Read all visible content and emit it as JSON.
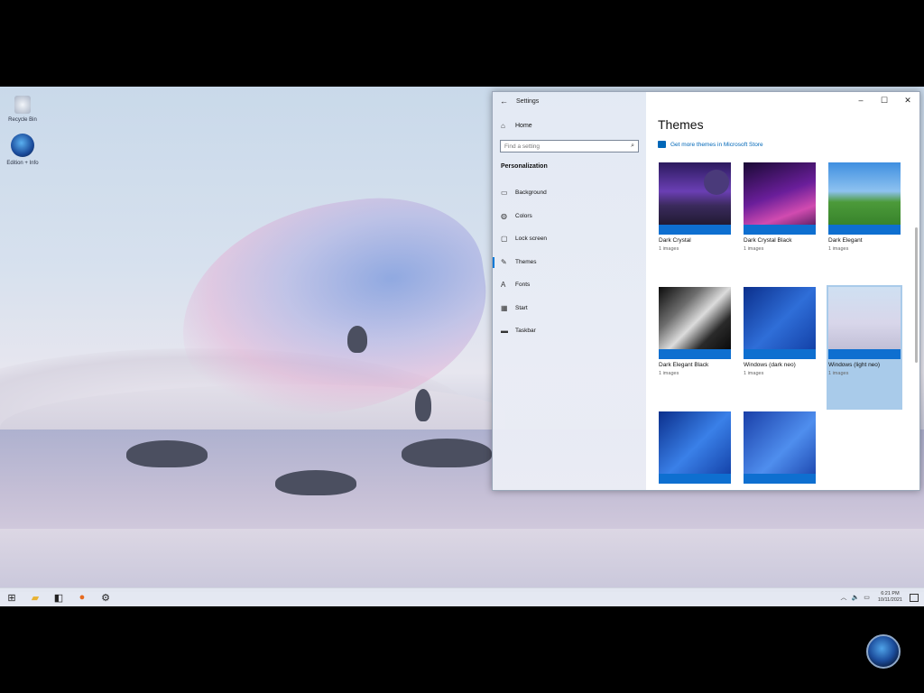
{
  "desktop": {
    "icons": [
      {
        "label": "Recycle Bin",
        "icon": "recycle-bin-icon"
      },
      {
        "label": "Edition + Info",
        "icon": "globe-icon"
      }
    ]
  },
  "settings": {
    "titlebar": {
      "title": "Settings",
      "back": "←"
    },
    "controls": {
      "minimize": "–",
      "maximize": "☐",
      "close": "✕"
    },
    "nav": {
      "home": "Home",
      "search_placeholder": "Find a setting",
      "section": "Personalization",
      "items": [
        {
          "label": "Background",
          "icon": "image-icon",
          "glyph": "▭"
        },
        {
          "label": "Colors",
          "icon": "palette-icon",
          "glyph": "◍"
        },
        {
          "label": "Lock screen",
          "icon": "lock-screen-icon",
          "glyph": "▢"
        },
        {
          "label": "Themes",
          "icon": "brush-icon",
          "glyph": "✎"
        },
        {
          "label": "Fonts",
          "icon": "font-icon",
          "glyph": "A"
        },
        {
          "label": "Start",
          "icon": "start-icon",
          "glyph": "▦"
        },
        {
          "label": "Taskbar",
          "icon": "taskbar-icon",
          "glyph": "▬"
        }
      ],
      "active": "Themes"
    },
    "content": {
      "title": "Themes",
      "store_link": "Get more themes in Microsoft Store",
      "themes": [
        {
          "name": "Dark Crystal",
          "count": "1 images"
        },
        {
          "name": "Dark Crystal Black",
          "count": "1 images"
        },
        {
          "name": "Dark Elegant",
          "count": "1 images"
        },
        {
          "name": "Dark Elegant Black",
          "count": "1 images"
        },
        {
          "name": "Windows (dark neo)",
          "count": "1 images"
        },
        {
          "name": "Windows (light neo)",
          "count": "1 images",
          "selected": true
        },
        {
          "name": "",
          "count": ""
        },
        {
          "name": "",
          "count": ""
        }
      ]
    }
  },
  "taskbar": {
    "apps": [
      {
        "icon": "start-icon",
        "glyph": "⊞"
      },
      {
        "icon": "file-explorer-icon",
        "glyph": "▰"
      },
      {
        "icon": "store-icon",
        "glyph": "◧"
      },
      {
        "icon": "firefox-icon",
        "glyph": "●"
      },
      {
        "icon": "settings-gear-icon",
        "glyph": "⚙"
      }
    ],
    "tray": {
      "time": "6:21 PM",
      "date": "10/11/2021"
    }
  },
  "colors": {
    "accent": "#0078d7",
    "link": "#0067b8",
    "selected_tile": "#a9cbea"
  }
}
